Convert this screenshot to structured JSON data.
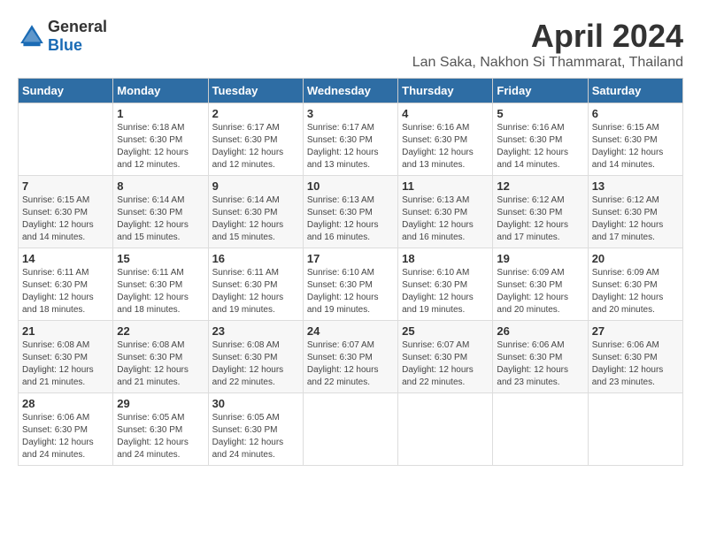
{
  "header": {
    "logo_general": "General",
    "logo_blue": "Blue",
    "month": "April 2024",
    "location": "Lan Saka, Nakhon Si Thammarat, Thailand"
  },
  "days_of_week": [
    "Sunday",
    "Monday",
    "Tuesday",
    "Wednesday",
    "Thursday",
    "Friday",
    "Saturday"
  ],
  "weeks": [
    [
      {
        "day": "",
        "info": ""
      },
      {
        "day": "1",
        "info": "Sunrise: 6:18 AM\nSunset: 6:30 PM\nDaylight: 12 hours\nand 12 minutes."
      },
      {
        "day": "2",
        "info": "Sunrise: 6:17 AM\nSunset: 6:30 PM\nDaylight: 12 hours\nand 12 minutes."
      },
      {
        "day": "3",
        "info": "Sunrise: 6:17 AM\nSunset: 6:30 PM\nDaylight: 12 hours\nand 13 minutes."
      },
      {
        "day": "4",
        "info": "Sunrise: 6:16 AM\nSunset: 6:30 PM\nDaylight: 12 hours\nand 13 minutes."
      },
      {
        "day": "5",
        "info": "Sunrise: 6:16 AM\nSunset: 6:30 PM\nDaylight: 12 hours\nand 14 minutes."
      },
      {
        "day": "6",
        "info": "Sunrise: 6:15 AM\nSunset: 6:30 PM\nDaylight: 12 hours\nand 14 minutes."
      }
    ],
    [
      {
        "day": "7",
        "info": "Sunrise: 6:15 AM\nSunset: 6:30 PM\nDaylight: 12 hours\nand 14 minutes."
      },
      {
        "day": "8",
        "info": "Sunrise: 6:14 AM\nSunset: 6:30 PM\nDaylight: 12 hours\nand 15 minutes."
      },
      {
        "day": "9",
        "info": "Sunrise: 6:14 AM\nSunset: 6:30 PM\nDaylight: 12 hours\nand 15 minutes."
      },
      {
        "day": "10",
        "info": "Sunrise: 6:13 AM\nSunset: 6:30 PM\nDaylight: 12 hours\nand 16 minutes."
      },
      {
        "day": "11",
        "info": "Sunrise: 6:13 AM\nSunset: 6:30 PM\nDaylight: 12 hours\nand 16 minutes."
      },
      {
        "day": "12",
        "info": "Sunrise: 6:12 AM\nSunset: 6:30 PM\nDaylight: 12 hours\nand 17 minutes."
      },
      {
        "day": "13",
        "info": "Sunrise: 6:12 AM\nSunset: 6:30 PM\nDaylight: 12 hours\nand 17 minutes."
      }
    ],
    [
      {
        "day": "14",
        "info": "Sunrise: 6:11 AM\nSunset: 6:30 PM\nDaylight: 12 hours\nand 18 minutes."
      },
      {
        "day": "15",
        "info": "Sunrise: 6:11 AM\nSunset: 6:30 PM\nDaylight: 12 hours\nand 18 minutes."
      },
      {
        "day": "16",
        "info": "Sunrise: 6:11 AM\nSunset: 6:30 PM\nDaylight: 12 hours\nand 19 minutes."
      },
      {
        "day": "17",
        "info": "Sunrise: 6:10 AM\nSunset: 6:30 PM\nDaylight: 12 hours\nand 19 minutes."
      },
      {
        "day": "18",
        "info": "Sunrise: 6:10 AM\nSunset: 6:30 PM\nDaylight: 12 hours\nand 19 minutes."
      },
      {
        "day": "19",
        "info": "Sunrise: 6:09 AM\nSunset: 6:30 PM\nDaylight: 12 hours\nand 20 minutes."
      },
      {
        "day": "20",
        "info": "Sunrise: 6:09 AM\nSunset: 6:30 PM\nDaylight: 12 hours\nand 20 minutes."
      }
    ],
    [
      {
        "day": "21",
        "info": "Sunrise: 6:08 AM\nSunset: 6:30 PM\nDaylight: 12 hours\nand 21 minutes."
      },
      {
        "day": "22",
        "info": "Sunrise: 6:08 AM\nSunset: 6:30 PM\nDaylight: 12 hours\nand 21 minutes."
      },
      {
        "day": "23",
        "info": "Sunrise: 6:08 AM\nSunset: 6:30 PM\nDaylight: 12 hours\nand 22 minutes."
      },
      {
        "day": "24",
        "info": "Sunrise: 6:07 AM\nSunset: 6:30 PM\nDaylight: 12 hours\nand 22 minutes."
      },
      {
        "day": "25",
        "info": "Sunrise: 6:07 AM\nSunset: 6:30 PM\nDaylight: 12 hours\nand 22 minutes."
      },
      {
        "day": "26",
        "info": "Sunrise: 6:06 AM\nSunset: 6:30 PM\nDaylight: 12 hours\nand 23 minutes."
      },
      {
        "day": "27",
        "info": "Sunrise: 6:06 AM\nSunset: 6:30 PM\nDaylight: 12 hours\nand 23 minutes."
      }
    ],
    [
      {
        "day": "28",
        "info": "Sunrise: 6:06 AM\nSunset: 6:30 PM\nDaylight: 12 hours\nand 24 minutes."
      },
      {
        "day": "29",
        "info": "Sunrise: 6:05 AM\nSunset: 6:30 PM\nDaylight: 12 hours\nand 24 minutes."
      },
      {
        "day": "30",
        "info": "Sunrise: 6:05 AM\nSunset: 6:30 PM\nDaylight: 12 hours\nand 24 minutes."
      },
      {
        "day": "",
        "info": ""
      },
      {
        "day": "",
        "info": ""
      },
      {
        "day": "",
        "info": ""
      },
      {
        "day": "",
        "info": ""
      }
    ]
  ]
}
